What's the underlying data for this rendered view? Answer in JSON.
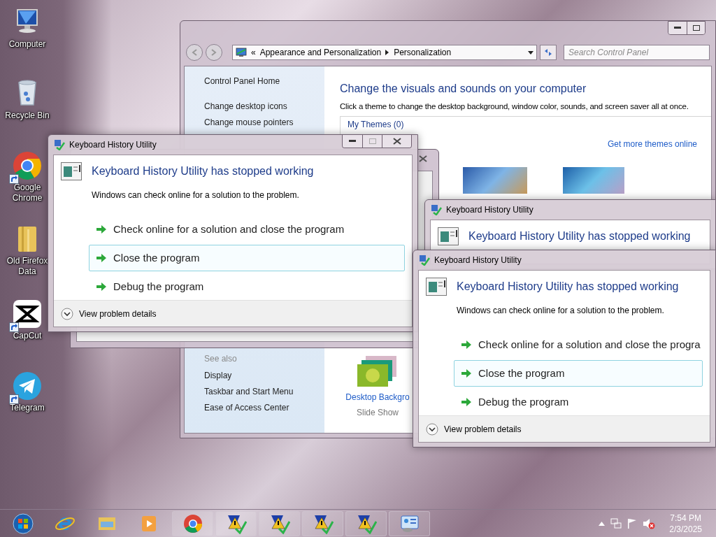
{
  "desktop_icons": [
    {
      "kind": "computer",
      "label": "Computer",
      "shortcut": false
    },
    {
      "kind": "recycle",
      "label": "Recycle Bin",
      "shortcut": false
    },
    {
      "kind": "chrome",
      "label": "Google Chrome",
      "shortcut": true
    },
    {
      "kind": "folder",
      "label": "Old Firefox Data",
      "shortcut": false
    },
    {
      "kind": "capcut",
      "label": "CapCut",
      "shortcut": true
    },
    {
      "kind": "telegram",
      "label": "Telegram",
      "shortcut": true
    }
  ],
  "control_panel": {
    "breadcrumb_overflow": "«",
    "breadcrumb": [
      "Appearance and Personalization",
      "Personalization"
    ],
    "search": {
      "placeholder": "Search Control Panel"
    },
    "sidebar_links": [
      "Control Panel Home",
      "Change desktop icons",
      "Change mouse pointers"
    ],
    "heading": "Change the visuals and sounds on your computer",
    "description": "Click a theme to change the desktop background, window color, sounds, and screen saver all at once.",
    "group_label": "My Themes (0)",
    "more_link": "Get more themes online",
    "see_also": {
      "label": "See also",
      "links": [
        "Display",
        "Taskbar and Start Menu",
        "Ease of Access Center"
      ]
    },
    "background_item": {
      "label": "Desktop Backgro",
      "sublabel": "Slide Show"
    }
  },
  "error_dialogs": [
    {
      "title": "Keyboard History Utility",
      "heading": "Keyboard History Utility has stopped working",
      "message": "Windows can check online for a solution to the problem.",
      "options": [
        {
          "label": "Check online for a solution and close the program",
          "selected": false
        },
        {
          "label": "Close the program",
          "selected": true
        },
        {
          "label": "Debug the program",
          "selected": false
        }
      ],
      "details": "View problem details"
    },
    {
      "title": "Keyboard History Utility",
      "heading": "Keyboard History Utility has stopped working"
    },
    {
      "title": "Keyboard History Utility",
      "heading": "Keyboard History Utility has stopped working",
      "message": "Windows can check online for a solution to the problem.",
      "options": [
        {
          "label": "Check online for a solution and close the progra",
          "selected": false
        },
        {
          "label": "Close the program",
          "selected": true
        },
        {
          "label": "Debug the program",
          "selected": false
        }
      ],
      "details": "View problem details"
    }
  ],
  "taskbar": {
    "pinned": [
      {
        "kind": "start"
      },
      {
        "kind": "ie"
      },
      {
        "kind": "explorer"
      },
      {
        "kind": "media"
      }
    ],
    "buttons": [
      {
        "kind": "chrome"
      },
      {
        "kind": "error"
      },
      {
        "kind": "error"
      },
      {
        "kind": "error"
      },
      {
        "kind": "error"
      },
      {
        "kind": "control"
      }
    ],
    "tray": {
      "volume_muted": true
    },
    "time": "7:54 PM",
    "date": "2/3/2025"
  }
}
